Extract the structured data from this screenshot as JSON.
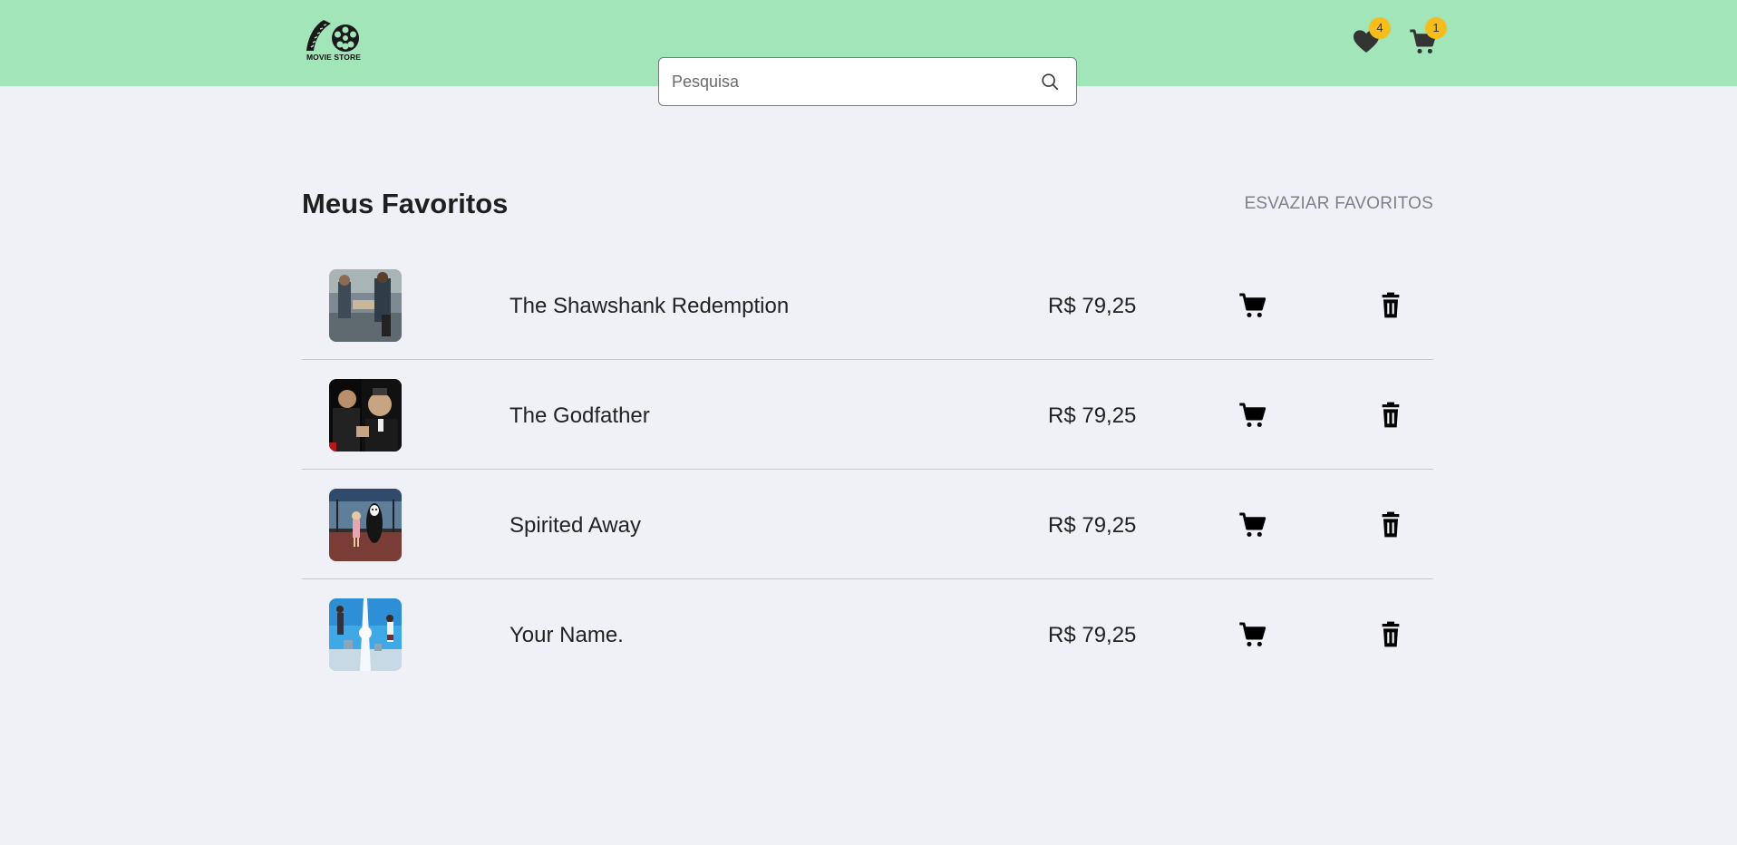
{
  "header": {
    "logo_text": "MOVIE STORE",
    "search_placeholder": "Pesquisa",
    "favorites_count": "4",
    "cart_count": "1"
  },
  "page": {
    "title": "Meus Favoritos",
    "clear_label": "ESVAZIAR FAVORITOS"
  },
  "favorites": [
    {
      "title": "The Shawshank Redemption",
      "price": "R$ 79,25"
    },
    {
      "title": "The Godfather",
      "price": "R$ 79,25"
    },
    {
      "title": "Spirited Away",
      "price": "R$ 79,25"
    },
    {
      "title": "Your Name.",
      "price": "R$ 79,25"
    }
  ],
  "colors": {
    "header_bg": "#a2e5b8",
    "page_bg": "#f0f1f6",
    "badge": "#f6bd1c"
  },
  "icons": {
    "favorites": "heart-icon",
    "cart": "cart-icon",
    "search": "search-icon",
    "row_cart": "add-to-cart-icon",
    "row_remove": "trash-icon"
  }
}
